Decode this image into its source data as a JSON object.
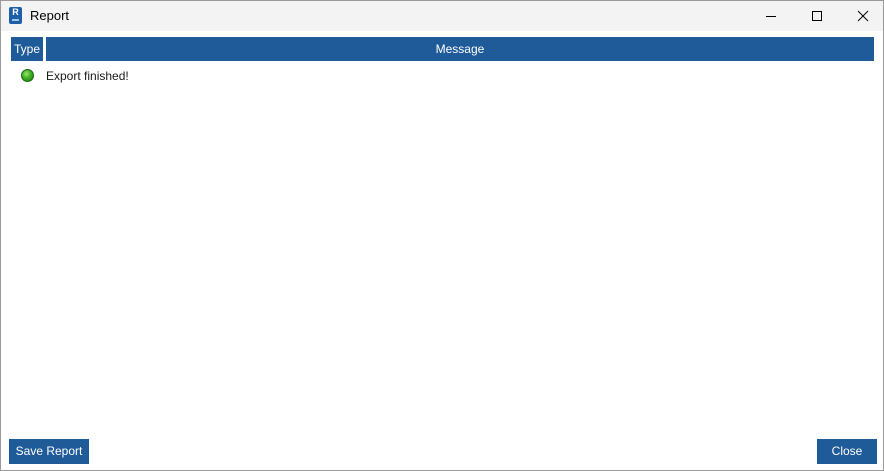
{
  "window": {
    "title": "Report",
    "app_icon_letter": "R",
    "icon": "revit-app-icon"
  },
  "controls": {
    "minimize_icon": "minimize-icon",
    "maximize_icon": "maximize-icon",
    "close_icon": "close-icon"
  },
  "table": {
    "columns": [
      "Type",
      "Message"
    ],
    "rows": [
      {
        "type_icon": "green-status-dot-icon",
        "type_color": "#3fae22",
        "message": "Export finished!"
      }
    ]
  },
  "footer": {
    "save_label": "Save Report",
    "close_label": "Close"
  },
  "colors": {
    "accent": "#1f5a99",
    "titlebar": "#f3f3f3"
  }
}
